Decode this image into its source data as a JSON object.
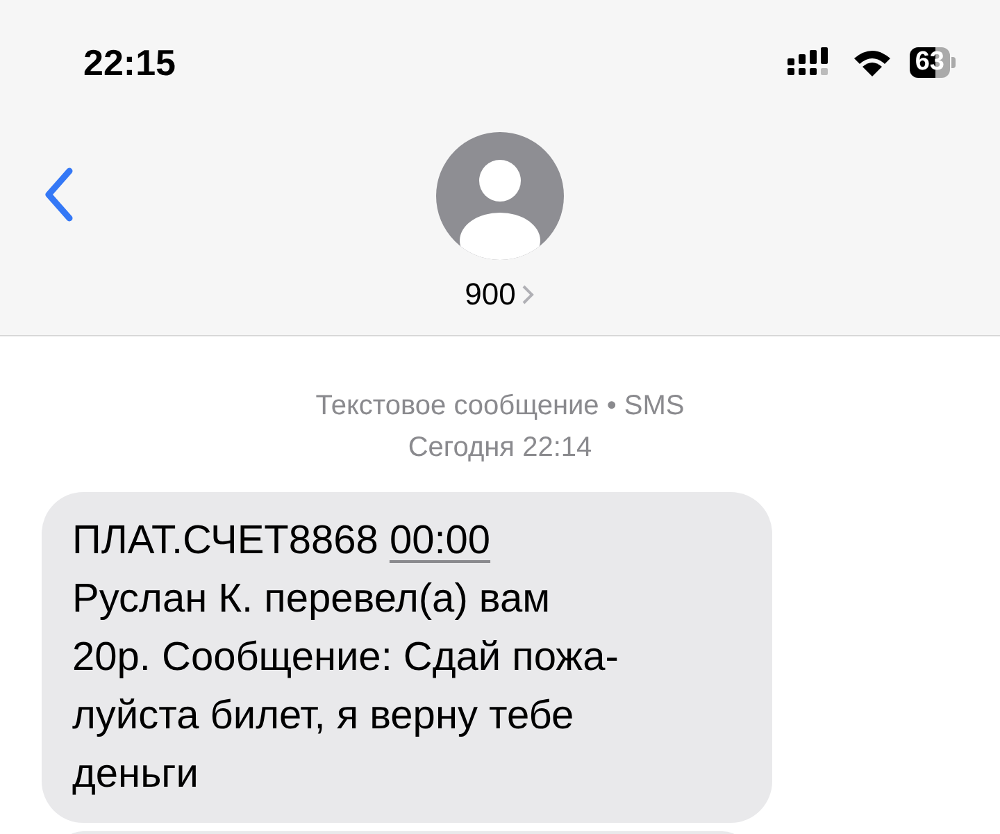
{
  "status_bar": {
    "time": "22:15",
    "battery": "63"
  },
  "header": {
    "contact": "900"
  },
  "meta": {
    "kind_line": "Текстовое сообщение • SMS",
    "date_line": "Сегодня 22:14"
  },
  "messages": [
    {
      "prefix": "ПЛАТ.СЧЕТ8868",
      "link": "00:00",
      "lines": [
        "Руслан К. перевел(а) вам",
        "20р. Сообщение: Сдай пожа-",
        "луйста билет, я верну тебе",
        "деньги"
      ]
    }
  ]
}
